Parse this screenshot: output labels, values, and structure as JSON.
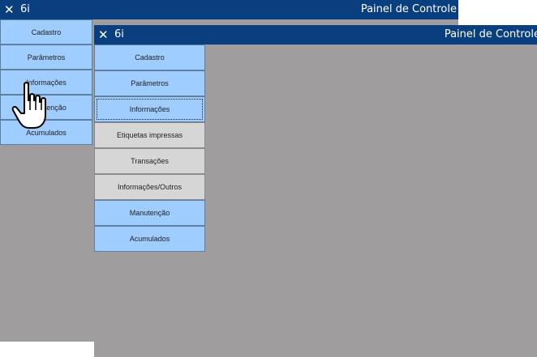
{
  "back_window": {
    "app_name": "6i",
    "panel_title": "Painel de Controle",
    "menu": [
      {
        "label": "Cadastro"
      },
      {
        "label": "Parâmetros"
      },
      {
        "label": "Informações"
      },
      {
        "label": "Manutenção"
      },
      {
        "label": "Acumulados"
      }
    ]
  },
  "front_window": {
    "app_name": "6i",
    "panel_title": "Painel de Controle",
    "menu": [
      {
        "label": "Cadastro",
        "style": "blue"
      },
      {
        "label": "Parâmetros",
        "style": "blue"
      },
      {
        "label": "Informações",
        "style": "blue",
        "focused": true
      },
      {
        "label": "Etiquetas impressas",
        "style": "gray"
      },
      {
        "label": "Transações",
        "style": "gray"
      },
      {
        "label": "Informações/Outros",
        "style": "gray"
      },
      {
        "label": "Manutenção",
        "style": "blue"
      },
      {
        "label": "Acumulados",
        "style": "blue"
      }
    ]
  },
  "colors": {
    "titlebar": "#0a3f7f",
    "menu_blue": "#9fcdff",
    "menu_gray": "#d6d6d6",
    "workspace": "#9f9d9e"
  },
  "cursor_icon": "hand-pointer-icon"
}
